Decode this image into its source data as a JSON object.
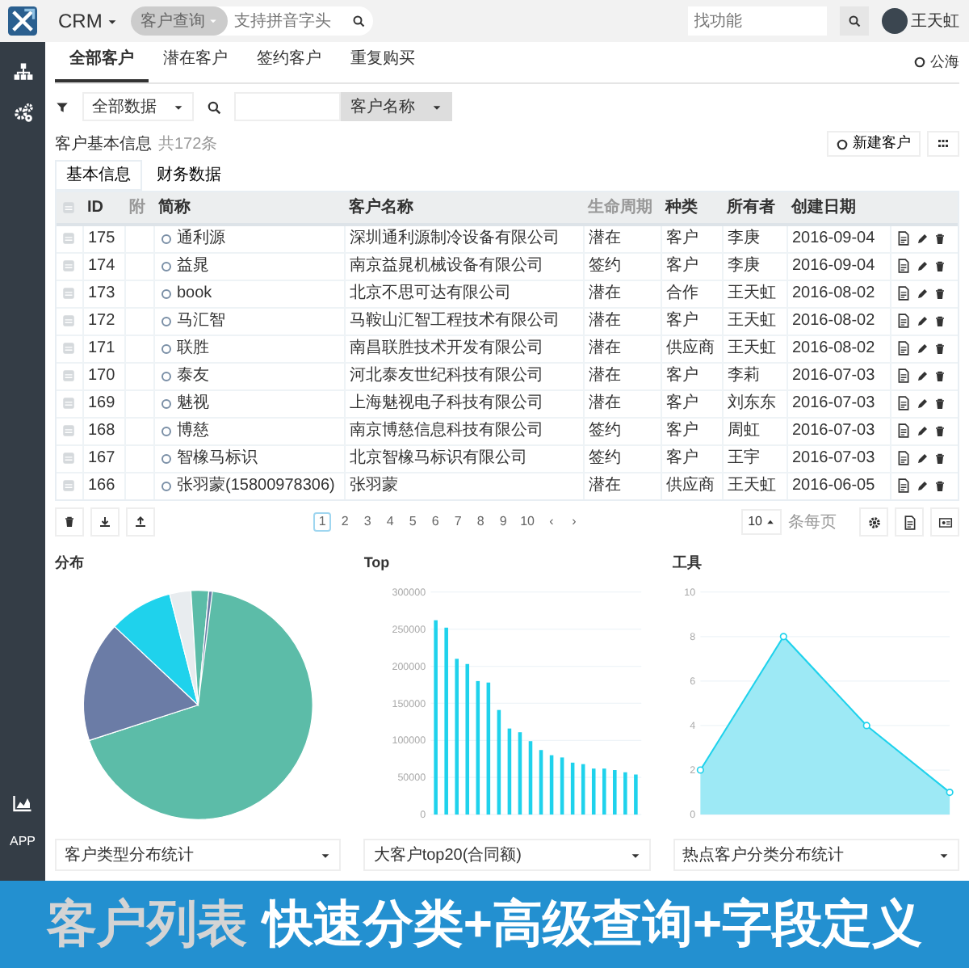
{
  "app": {
    "title": "CRM",
    "search_scope": "客户查询",
    "search_placeholder": "支持拼音字头",
    "function_search_placeholder": "找功能",
    "user": "王天虹"
  },
  "sidebar": {
    "label": "APP"
  },
  "tabs": [
    {
      "label": "全部客户",
      "selected": true
    },
    {
      "label": "潜在客户",
      "selected": false
    },
    {
      "label": "签约客户",
      "selected": false
    },
    {
      "label": "重复购买",
      "selected": false
    }
  ],
  "public_pool": "公海",
  "filter": {
    "scope": "全部数据",
    "field": "客户名称"
  },
  "list": {
    "title": "客户基本信息",
    "count": "共172条",
    "new_button": "新建客户"
  },
  "subtabs": [
    {
      "label": "基本信息",
      "selected": true
    },
    {
      "label": "财务数据",
      "selected": false
    }
  ],
  "table": {
    "header_checked": false,
    "columns": [
      {
        "label": "ID",
        "muted": false
      },
      {
        "label": "附",
        "muted": true
      },
      {
        "label": "简称",
        "muted": false
      },
      {
        "label": "客户名称",
        "muted": false
      },
      {
        "label": "生命周期",
        "muted": true
      },
      {
        "label": "种类",
        "muted": false
      },
      {
        "label": "所有者",
        "muted": false
      },
      {
        "label": "创建日期",
        "muted": false
      }
    ],
    "rows": [
      {
        "checked": false,
        "id": "175",
        "name": "通利源",
        "company": "深圳通利源制冷设备有限公司",
        "stage": "潜在",
        "type": "客户",
        "owner": "李庚",
        "created": "2016-09-04"
      },
      {
        "checked": false,
        "id": "174",
        "name": "益晁",
        "company": "南京益晁机械设备有限公司",
        "stage": "签约",
        "type": "客户",
        "owner": "李庚",
        "created": "2016-09-04"
      },
      {
        "checked": false,
        "id": "173",
        "name": "book",
        "company": "北京不思可达有限公司",
        "stage": "潜在",
        "type": "合作",
        "owner": "王天虹",
        "created": "2016-08-02"
      },
      {
        "checked": false,
        "id": "172",
        "name": "马汇智",
        "company": "马鞍山汇智工程技术有限公司",
        "stage": "潜在",
        "type": "客户",
        "owner": "王天虹",
        "created": "2016-08-02"
      },
      {
        "checked": false,
        "id": "171",
        "name": "联胜",
        "company": "南昌联胜技术开发有限公司",
        "stage": "潜在",
        "type": "供应商",
        "owner": "王天虹",
        "created": "2016-08-02"
      },
      {
        "checked": false,
        "id": "170",
        "name": "泰友",
        "company": "河北泰友世纪科技有限公司",
        "stage": "潜在",
        "type": "客户",
        "owner": "李莉",
        "created": "2016-07-03"
      },
      {
        "checked": false,
        "id": "169",
        "name": "魅视",
        "company": "上海魅视电子科技有限公司",
        "stage": "潜在",
        "type": "客户",
        "owner": "刘东东",
        "created": "2016-07-03"
      },
      {
        "checked": false,
        "id": "168",
        "name": "博慈",
        "company": "南京博慈信息科技有限公司",
        "stage": "签约",
        "type": "客户",
        "owner": "周虹",
        "created": "2016-07-03"
      },
      {
        "checked": false,
        "id": "167",
        "name": "智橡马标识",
        "company": "北京智橡马标识有限公司",
        "stage": "签约",
        "type": "客户",
        "owner": "王宇",
        "created": "2016-07-03"
      },
      {
        "checked": false,
        "id": "166",
        "name": "张羽蒙(15800978306)",
        "company": "张羽蒙",
        "stage": "潜在",
        "type": "供应商",
        "owner": "王天虹",
        "created": "2016-06-05"
      }
    ]
  },
  "pagination": {
    "prev": "‹",
    "next": "›",
    "page_size": "10",
    "per_page_label": "条每页",
    "pages": [
      {
        "label": "1",
        "selected": true
      },
      {
        "label": "2",
        "selected": false
      },
      {
        "label": "3",
        "selected": false
      },
      {
        "label": "4",
        "selected": false
      },
      {
        "label": "5",
        "selected": false
      },
      {
        "label": "6",
        "selected": false
      },
      {
        "label": "7",
        "selected": false
      },
      {
        "label": "8",
        "selected": false
      },
      {
        "label": "9",
        "selected": false
      },
      {
        "label": "10",
        "selected": false
      }
    ]
  },
  "charts": [
    {
      "kind": "pie",
      "title": "分布",
      "select": "客户类型分布统计"
    },
    {
      "kind": "chart",
      "title": "Top",
      "select": "大客户top20(合同额)",
      "chart_data": {
        "type": "bar",
        "grid": true,
        "ylim": [
          0,
          300000
        ],
        "yticks": [
          0,
          50000,
          100000,
          150000,
          200000,
          250000,
          300000
        ],
        "values": [
          262000,
          252000,
          210000,
          203000,
          180000,
          178000,
          141000,
          116000,
          111000,
          99000,
          87000,
          80000,
          77000,
          70000,
          68000,
          62000,
          62000,
          60000,
          57000,
          54000
        ]
      }
    },
    {
      "kind": "chart",
      "title": "工具",
      "select": "热点客户分类分布统计",
      "chart_data": {
        "type": "area",
        "grid": true,
        "ylim": [
          0,
          10
        ],
        "yticks": [
          0,
          2,
          4,
          6,
          8,
          10
        ],
        "values": [
          2,
          8,
          4,
          1
        ]
      }
    }
  ],
  "banner": {
    "title": "客户列表",
    "subtitle": "快速分类+高级查询+字段定义"
  }
}
